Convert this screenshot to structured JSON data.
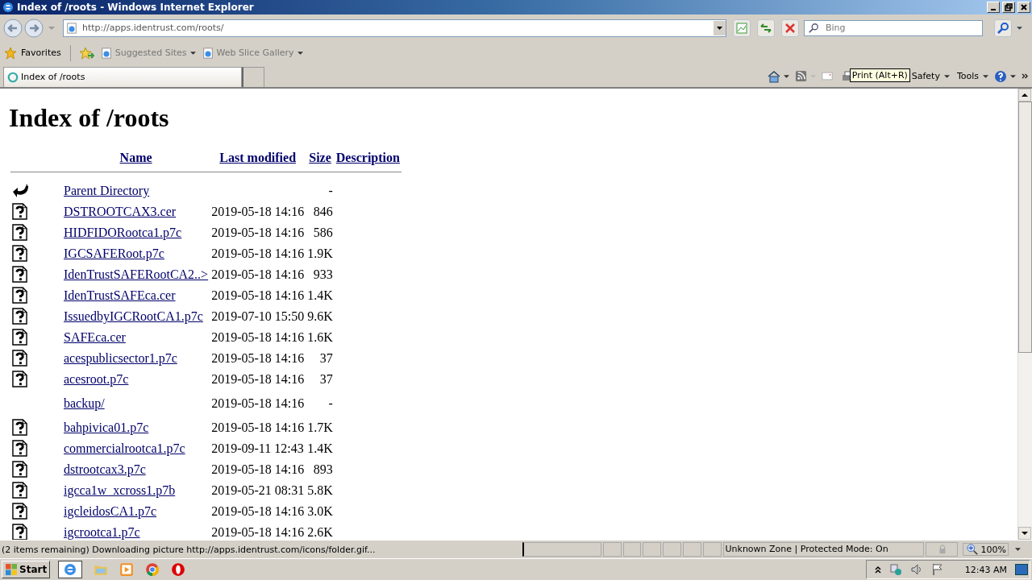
{
  "window": {
    "title": "Index of /roots - Windows Internet Explorer"
  },
  "address_bar": {
    "url": "http://apps.identrust.com/roots/",
    "search_placeholder": "Bing"
  },
  "favorites_bar": {
    "label": "Favorites",
    "links": [
      "Suggested Sites",
      "Web Slice Gallery"
    ]
  },
  "tabs": [
    {
      "label": "Index of /roots",
      "selected": true
    }
  ],
  "command_bar": {
    "items": [
      "Safety",
      "Tools"
    ],
    "tooltip": "Print (Alt+R)"
  },
  "page": {
    "heading": "Index of /roots",
    "columns": [
      "Name",
      "Last modified",
      "Size",
      "Description"
    ],
    "rows": [
      {
        "kind": "parent",
        "name": "Parent Directory",
        "modified": "",
        "size": "-"
      },
      {
        "kind": "file",
        "name": "DSTROOTCAX3.cer",
        "modified": "2019-05-18 14:16",
        "size": "846"
      },
      {
        "kind": "file",
        "name": "HIDFIDORootca1.p7c",
        "modified": "2019-05-18 14:16",
        "size": "586"
      },
      {
        "kind": "file",
        "name": "IGCSAFERoot.p7c",
        "modified": "2019-05-18 14:16",
        "size": "1.9K"
      },
      {
        "kind": "file",
        "name": "IdenTrustSAFERootCA2..>",
        "modified": "2019-05-18 14:16",
        "size": "933"
      },
      {
        "kind": "file",
        "name": "IdenTrustSAFEca.cer",
        "modified": "2019-05-18 14:16",
        "size": "1.4K"
      },
      {
        "kind": "file",
        "name": "IssuedbyIGCRootCA1.p7c",
        "modified": "2019-07-10 15:50",
        "size": "9.6K"
      },
      {
        "kind": "file",
        "name": "SAFEca.cer",
        "modified": "2019-05-18 14:16",
        "size": "1.6K"
      },
      {
        "kind": "file",
        "name": "acespublicsector1.p7c",
        "modified": "2019-05-18 14:16",
        "size": "37"
      },
      {
        "kind": "file",
        "name": "acesroot.p7c",
        "modified": "2019-05-18 14:16",
        "size": "37"
      },
      {
        "kind": "folder",
        "name": "backup/",
        "modified": "2019-05-18 14:16",
        "size": "-"
      },
      {
        "kind": "file",
        "name": "bahpivica01.p7c",
        "modified": "2019-05-18 14:16",
        "size": "1.7K"
      },
      {
        "kind": "file",
        "name": "commercialrootca1.p7c",
        "modified": "2019-09-11 12:43",
        "size": "1.4K"
      },
      {
        "kind": "file",
        "name": "dstrootcax3.p7c",
        "modified": "2019-05-18 14:16",
        "size": "893"
      },
      {
        "kind": "file",
        "name": "igcca1w_xcross1.p7b",
        "modified": "2019-05-21 08:31",
        "size": "5.8K"
      },
      {
        "kind": "file",
        "name": "igcleidosCA1.p7c",
        "modified": "2019-05-18 14:16",
        "size": "3.0K"
      },
      {
        "kind": "file",
        "name": "igcrootca1.p7c",
        "modified": "2019-05-18 14:16",
        "size": "2.6K"
      }
    ]
  },
  "status_bar": {
    "text": "(2 items remaining) Downloading picture http://apps.identrust.com/icons/folder.gif...",
    "zone": "Unknown Zone | Protected Mode: On",
    "zoom": "100%"
  },
  "taskbar": {
    "start": "Start",
    "clock": "12:43 AM"
  }
}
